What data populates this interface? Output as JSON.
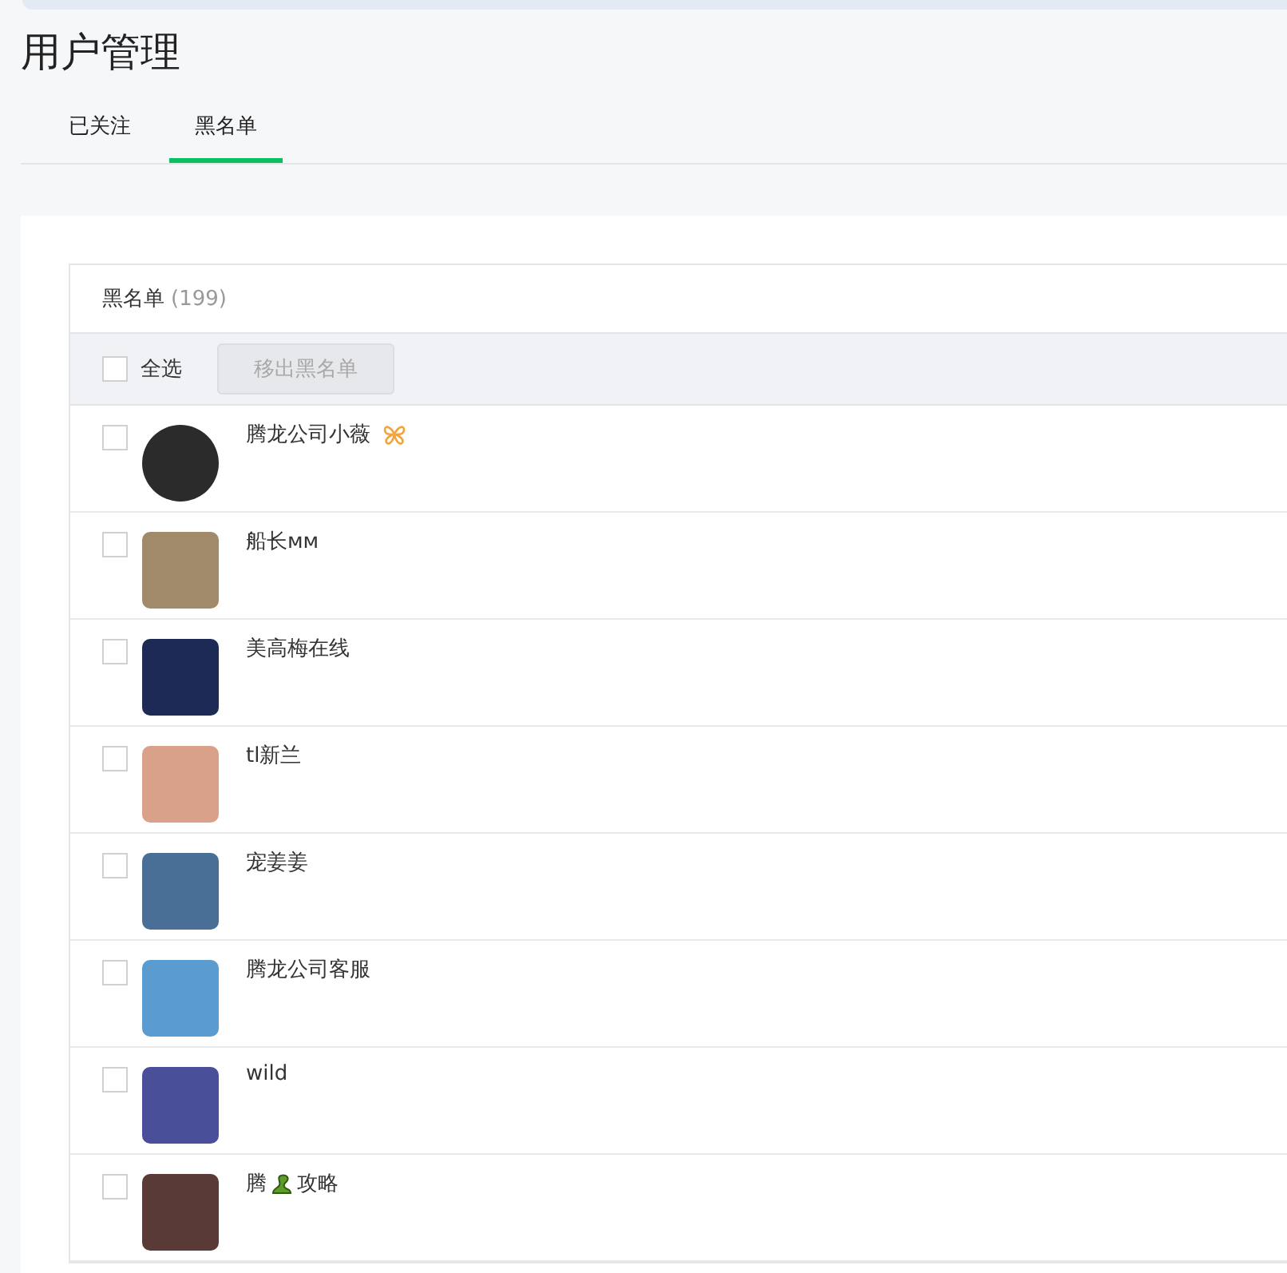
{
  "page_title": "用户管理",
  "tabs": [
    {
      "label": "已关注",
      "selected": false
    },
    {
      "label": "黑名单",
      "selected": true
    }
  ],
  "list": {
    "title": "黑名单",
    "count": "(199)",
    "select_all": {
      "label": "全选",
      "checked": false
    },
    "action_button": {
      "label": "移出黑名单",
      "disabled": true
    },
    "rows": [
      {
        "kind": "badge",
        "checked": false,
        "round_avatar": true,
        "name": "腾龙公司小薇"
      },
      {
        "kind": "plain",
        "checked": false,
        "round_avatar": false,
        "name": "船长ᴍᴍ"
      },
      {
        "kind": "plain",
        "checked": false,
        "round_avatar": false,
        "name": "美高梅在线"
      },
      {
        "kind": "plain",
        "checked": false,
        "round_avatar": false,
        "name": "tl新兰"
      },
      {
        "kind": "plain",
        "checked": false,
        "round_avatar": false,
        "name": "宠姜姜"
      },
      {
        "kind": "plain",
        "checked": false,
        "round_avatar": false,
        "name": "腾龙公司客服"
      },
      {
        "kind": "plain",
        "checked": false,
        "round_avatar": false,
        "name": "wild"
      },
      {
        "kind": "emoji",
        "checked": false,
        "round_avatar": false,
        "name": "腾",
        "name_tail": "攻略"
      }
    ]
  }
}
